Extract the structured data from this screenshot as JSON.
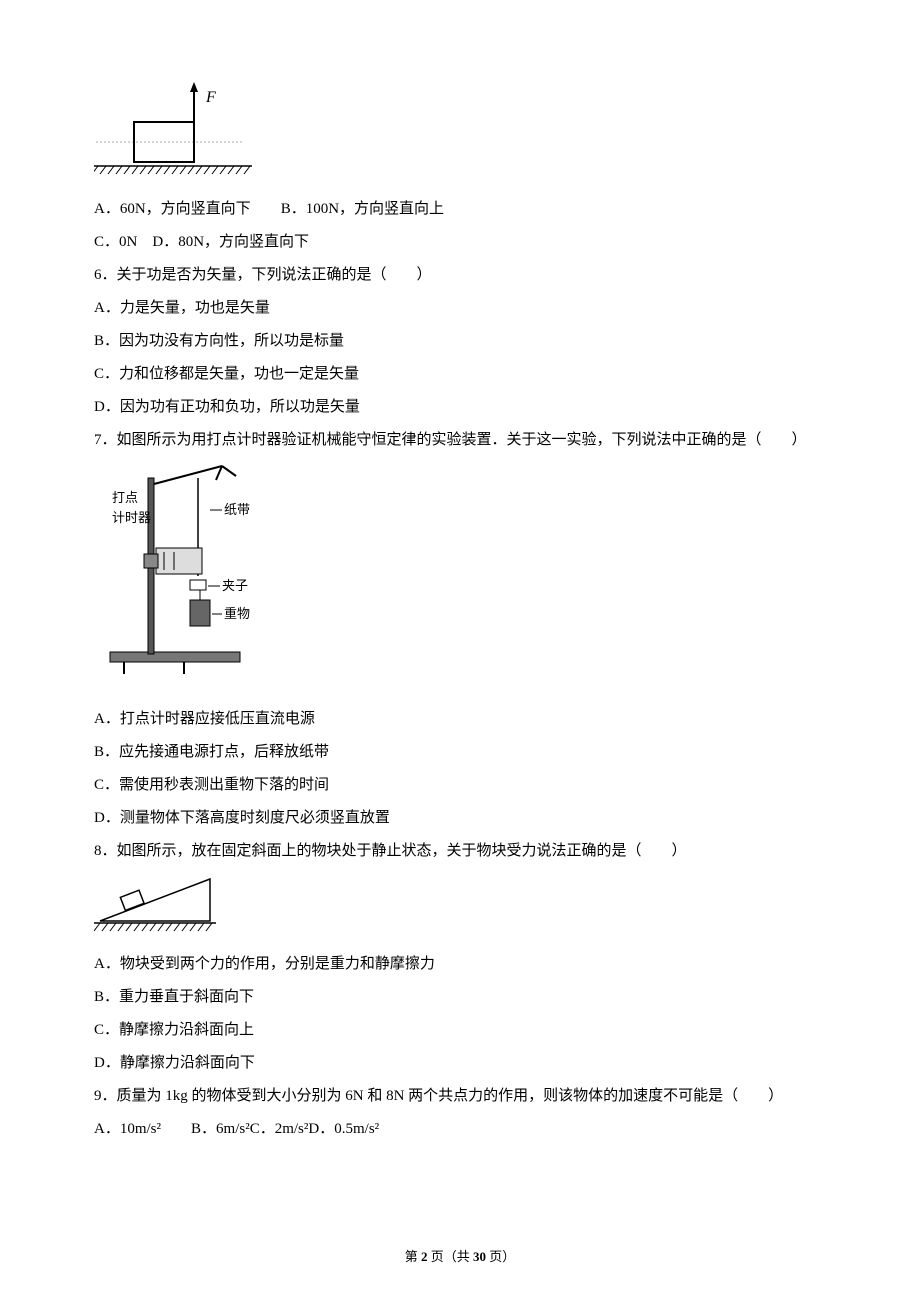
{
  "fig5": {
    "label_F": "F"
  },
  "q5": {
    "optA": "A．60N，方向竖直向下",
    "optB": "B．100N，方向竖直向上",
    "optC": "C．0N",
    "optD": "D．80N，方向竖直向下"
  },
  "q6": {
    "stem": "6．关于功是否为矢量，下列说法正确的是（　　）",
    "optA": "A．力是矢量，功也是矢量",
    "optB": "B．因为功没有方向性，所以功是标量",
    "optC": "C．力和位移都是矢量，功也一定是矢量",
    "optD": "D．因为功有正功和负功，所以功是矢量"
  },
  "q7": {
    "stem": "7．如图所示为用打点计时器验证机械能守恒定律的实验装置．关于这一实验，下列说法中正确的是（　　）",
    "fig": {
      "label1": "打点",
      "label2": "计时器",
      "label3": "纸带",
      "label4": "夹子",
      "label5": "重物"
    },
    "optA": "A．打点计时器应接低压直流电源",
    "optB": "B．应先接通电源打点，后释放纸带",
    "optC": "C．需使用秒表测出重物下落的时间",
    "optD": "D．测量物体下落高度时刻度尺必须竖直放置"
  },
  "q8": {
    "stem": "8．如图所示，放在固定斜面上的物块处于静止状态，关于物块受力说法正确的是（　　）",
    "optA": "A．物块受到两个力的作用，分别是重力和静摩擦力",
    "optB": "B．重力垂直于斜面向下",
    "optC": "C．静摩擦力沿斜面向上",
    "optD": "D．静摩擦力沿斜面向下"
  },
  "q9": {
    "stem": "9．质量为 1kg 的物体受到大小分别为 6N 和 8N 两个共点力的作用，则该物体的加速度不可能是（　　）",
    "optA": "A．10m/s²",
    "optB": "B．6m/s²",
    "optC": "C．2m/s²",
    "optD": "D．0.5m/s²"
  },
  "footer": {
    "prefix": "第 ",
    "page_cur": "2",
    "mid": " 页（共 ",
    "page_total": "30",
    "suffix": " 页）"
  }
}
